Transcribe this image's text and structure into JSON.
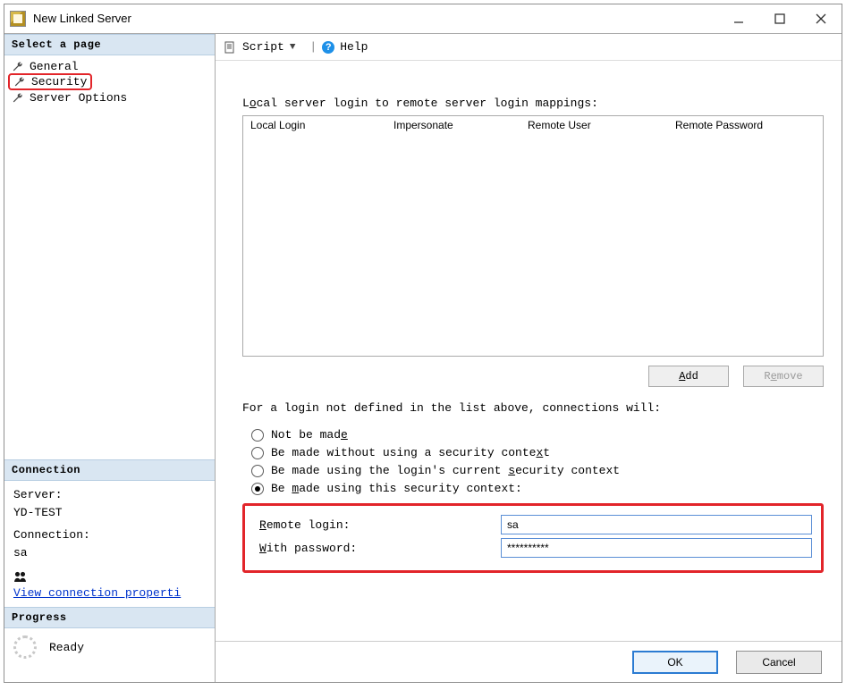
{
  "window": {
    "title": "New Linked Server"
  },
  "winbuttons": {
    "min": "minimize",
    "max": "maximize",
    "close": "close"
  },
  "sidebar": {
    "select_header": "Select a page",
    "pages": [
      {
        "label": "General"
      },
      {
        "label": "Security"
      },
      {
        "label": "Server Options"
      }
    ],
    "connection_header": "Connection",
    "server_label": "Server:",
    "server_value": "YD-TEST",
    "connection_label": "Connection:",
    "connection_value": "sa",
    "view_link": "View connection properti",
    "progress_header": "Progress",
    "progress_status": "Ready"
  },
  "toolbar": {
    "script": "Script",
    "help": "Help"
  },
  "main": {
    "mappings_label_pre": "L",
    "mappings_label_u": "o",
    "mappings_label_post": "cal server login to remote server login mappings:",
    "grid": {
      "headers": {
        "local": "Local Login",
        "impersonate": "Impersonate",
        "remote_user": "Remote User",
        "remote_password": "Remote Password"
      },
      "rows": []
    },
    "add_pre": "",
    "add_u": "A",
    "add_post": "dd",
    "remove_pre": "R",
    "remove_u": "e",
    "remove_post": "move",
    "explain": "For a login not defined in the list above, connections will:",
    "options": {
      "o1_pre": "Not be mad",
      "o1_u": "e",
      "o1_post": "",
      "o2_pre": "Be made without using a security conte",
      "o2_u": "x",
      "o2_post": "t",
      "o3_pre": "Be made using the login's current ",
      "o3_u": "s",
      "o3_post": "ecurity context",
      "o4_pre": "Be ",
      "o4_u": "m",
      "o4_post": "ade using this security context:",
      "selected_index": 3
    },
    "remote_login_label_u": "R",
    "remote_login_label_post": "emote login:",
    "remote_login_value": "sa",
    "with_password_label_u": "W",
    "with_password_label_post": "ith password:",
    "with_password_value": "**********"
  },
  "footer": {
    "ok": "OK",
    "cancel": "Cancel"
  }
}
